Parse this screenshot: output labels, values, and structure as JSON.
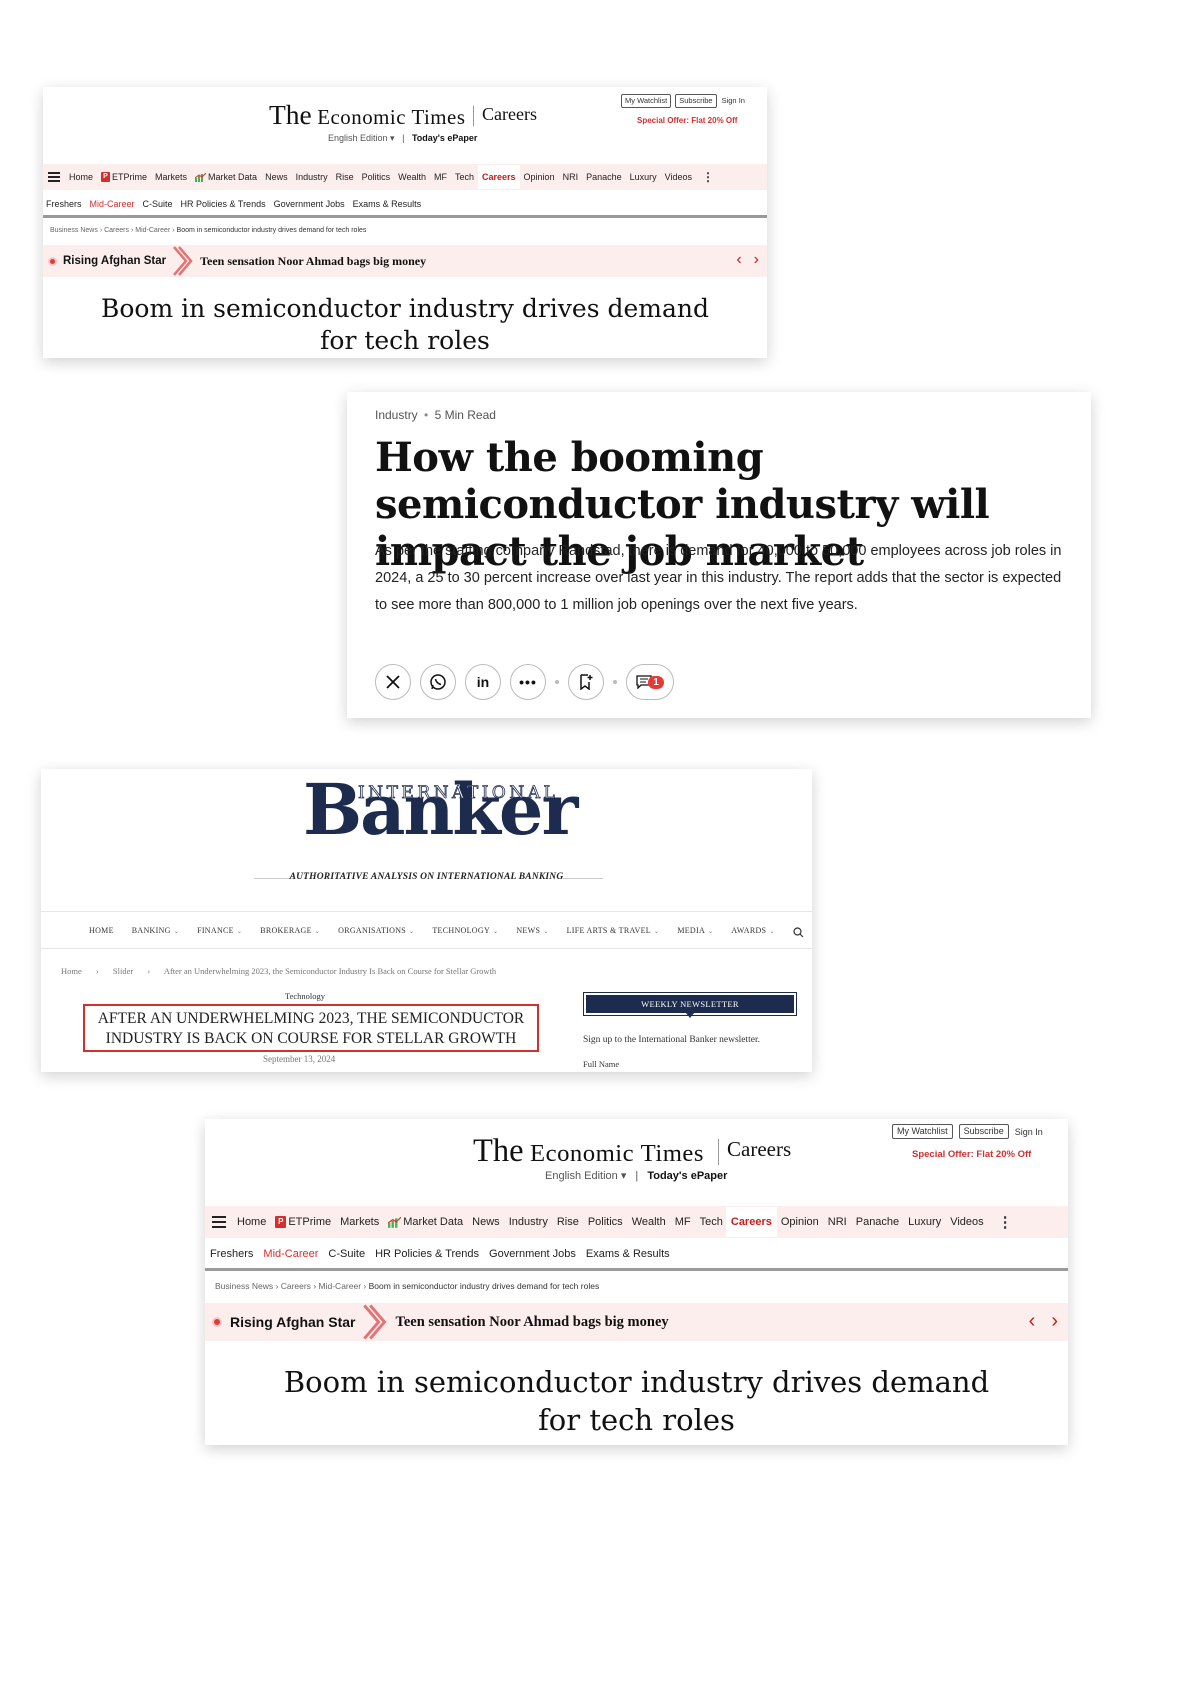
{
  "et": {
    "logo_the": "The",
    "logo_economic": "Economic",
    "logo_times": "Times",
    "section": "Careers",
    "edition": "English Edition ▾",
    "edition_sep": "|",
    "epaper": "Today's ePaper",
    "watchlist": "My Watchlist",
    "subscribe": "Subscribe",
    "signin": "Sign In",
    "offer": "Special Offer: Flat 20% Off",
    "nav": {
      "home": "Home",
      "etprime": "ETPrime",
      "markets": "Markets",
      "market_data": "Market Data",
      "news": "News",
      "industry": "Industry",
      "rise": "Rise",
      "politics": "Politics",
      "wealth": "Wealth",
      "mf": "MF",
      "tech": "Tech",
      "careers": "Careers",
      "opinion": "Opinion",
      "nri": "NRI",
      "panache": "Panache",
      "luxury": "Luxury",
      "videos": "Videos",
      "more": "⋮"
    },
    "subnav": [
      "Freshers",
      "Mid-Career",
      "C-Suite",
      "HR Policies & Trends",
      "Government Jobs",
      "Exams & Results"
    ],
    "breadcrumb": {
      "p1": "Business News",
      "p2": "Careers",
      "p3": "Mid-Career",
      "current": "Boom in semiconductor industry drives demand for tech roles",
      "sep": "›"
    },
    "ticker_label": "Rising Afghan Star",
    "ticker_headline": "Teen sensation Noor Ahmad bags big money",
    "prev": "‹",
    "next": "›",
    "headline_line1": "Boom in semiconductor industry drives demand",
    "headline_line2": "for tech roles"
  },
  "article": {
    "category": "Industry",
    "dot": "•",
    "read_time": "5 Min Read",
    "title": "How the booming semiconductor industry will impact the job market",
    "body": "As per the staffing company Randstad, there is demand for 40,000 to 50,000 employees across job roles in 2024, a 25 to 30 percent increase over last year in this industry. The report adds that the sector is expected to see more than 800,000 to 1 million job openings over the next five years.",
    "comment_count": "1",
    "share_icons": [
      "x-icon",
      "whatsapp-icon",
      "linkedin-icon",
      "more-icon",
      "bookmark-icon",
      "comment-icon"
    ]
  },
  "ib": {
    "logo_international": "INTERNATIONAL",
    "logo_banker": "Banker",
    "tagline": "AUTHORITATIVE ANALYSIS ON INTERNATIONAL BANKING",
    "nav": [
      {
        "label": "HOME",
        "caret": ""
      },
      {
        "label": "BANKING",
        "caret": "⌄"
      },
      {
        "label": "FINANCE",
        "caret": "⌄"
      },
      {
        "label": "BROKERAGE",
        "caret": "⌄"
      },
      {
        "label": "ORGANISATIONS",
        "caret": "⌄"
      },
      {
        "label": "TECHNOLOGY",
        "caret": "⌄"
      },
      {
        "label": "NEWS",
        "caret": "⌄"
      },
      {
        "label": "LIFE ARTS & TRAVEL",
        "caret": "⌄"
      },
      {
        "label": "MEDIA",
        "caret": "⌄"
      },
      {
        "label": "AWARDS",
        "caret": "⌄"
      }
    ],
    "breadcrumb": {
      "home": "Home",
      "slider": "Slider",
      "current": "After an Underwhelming 2023, the Semiconductor Industry Is Back on Course for Stellar Growth",
      "sep": "›"
    },
    "category": "Technology",
    "title_line1": "AFTER AN UNDERWHELMING 2023, THE SEMICONDUCTOR",
    "title_line2": "INDUSTRY IS BACK ON COURSE FOR STELLAR GROWTH",
    "date": "September 13, 2024",
    "newsletter_heading": "WEEKLY NEWSLETTER",
    "newsletter_text": "Sign up to the International Banker newsletter.",
    "full_name_label": "Full Name"
  },
  "colors": {
    "et_red": "#d32f2f",
    "et_nav_bg": "#fdeeee",
    "ib_navy": "#1d2b4f",
    "ib_highlight_box": "#d0312d"
  }
}
